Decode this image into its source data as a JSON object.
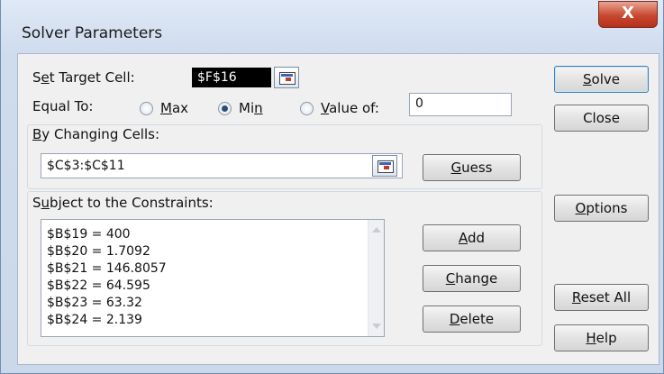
{
  "window": {
    "title": "Solver Parameters",
    "close_glyph": "X"
  },
  "target_cell": {
    "label_pre": "S",
    "label_u": "e",
    "label_post": "t Target Cell:",
    "value": "$F$16"
  },
  "equal_to": {
    "label": "Equal To:",
    "options": [
      {
        "pre": "",
        "u": "M",
        "post": "ax",
        "checked": false
      },
      {
        "pre": "Mi",
        "u": "n",
        "post": "",
        "checked": true
      },
      {
        "pre": "",
        "u": "V",
        "post": "alue of:",
        "checked": false
      }
    ],
    "value_of": "0"
  },
  "changing_cells": {
    "label_pre": "",
    "label_u": "B",
    "label_post": "y Changing Cells:",
    "value": "$C$3:$C$11",
    "guess_pre": "",
    "guess_u": "G",
    "guess_post": "uess"
  },
  "constraints": {
    "label_pre": "S",
    "label_u": "u",
    "label_post": "bject to the Constraints:",
    "items": [
      "$B$19 = 400",
      "$B$20 = 1.7092",
      "$B$21 = 146.8057",
      "$B$22 = 64.595",
      "$B$23 = 63.32",
      "$B$24 = 2.139"
    ]
  },
  "constraint_buttons": {
    "add": {
      "pre": "",
      "u": "A",
      "post": "dd"
    },
    "change": {
      "pre": "",
      "u": "C",
      "post": "hange"
    },
    "delete": {
      "pre": "",
      "u": "D",
      "post": "elete"
    }
  },
  "side_buttons": {
    "solve": {
      "pre": "",
      "u": "S",
      "post": "olve"
    },
    "close": "Close",
    "options": {
      "pre": "",
      "u": "O",
      "post": "ptions"
    },
    "reset": {
      "pre": "",
      "u": "R",
      "post": "eset All"
    },
    "help": {
      "pre": "",
      "u": "H",
      "post": "elp"
    }
  }
}
